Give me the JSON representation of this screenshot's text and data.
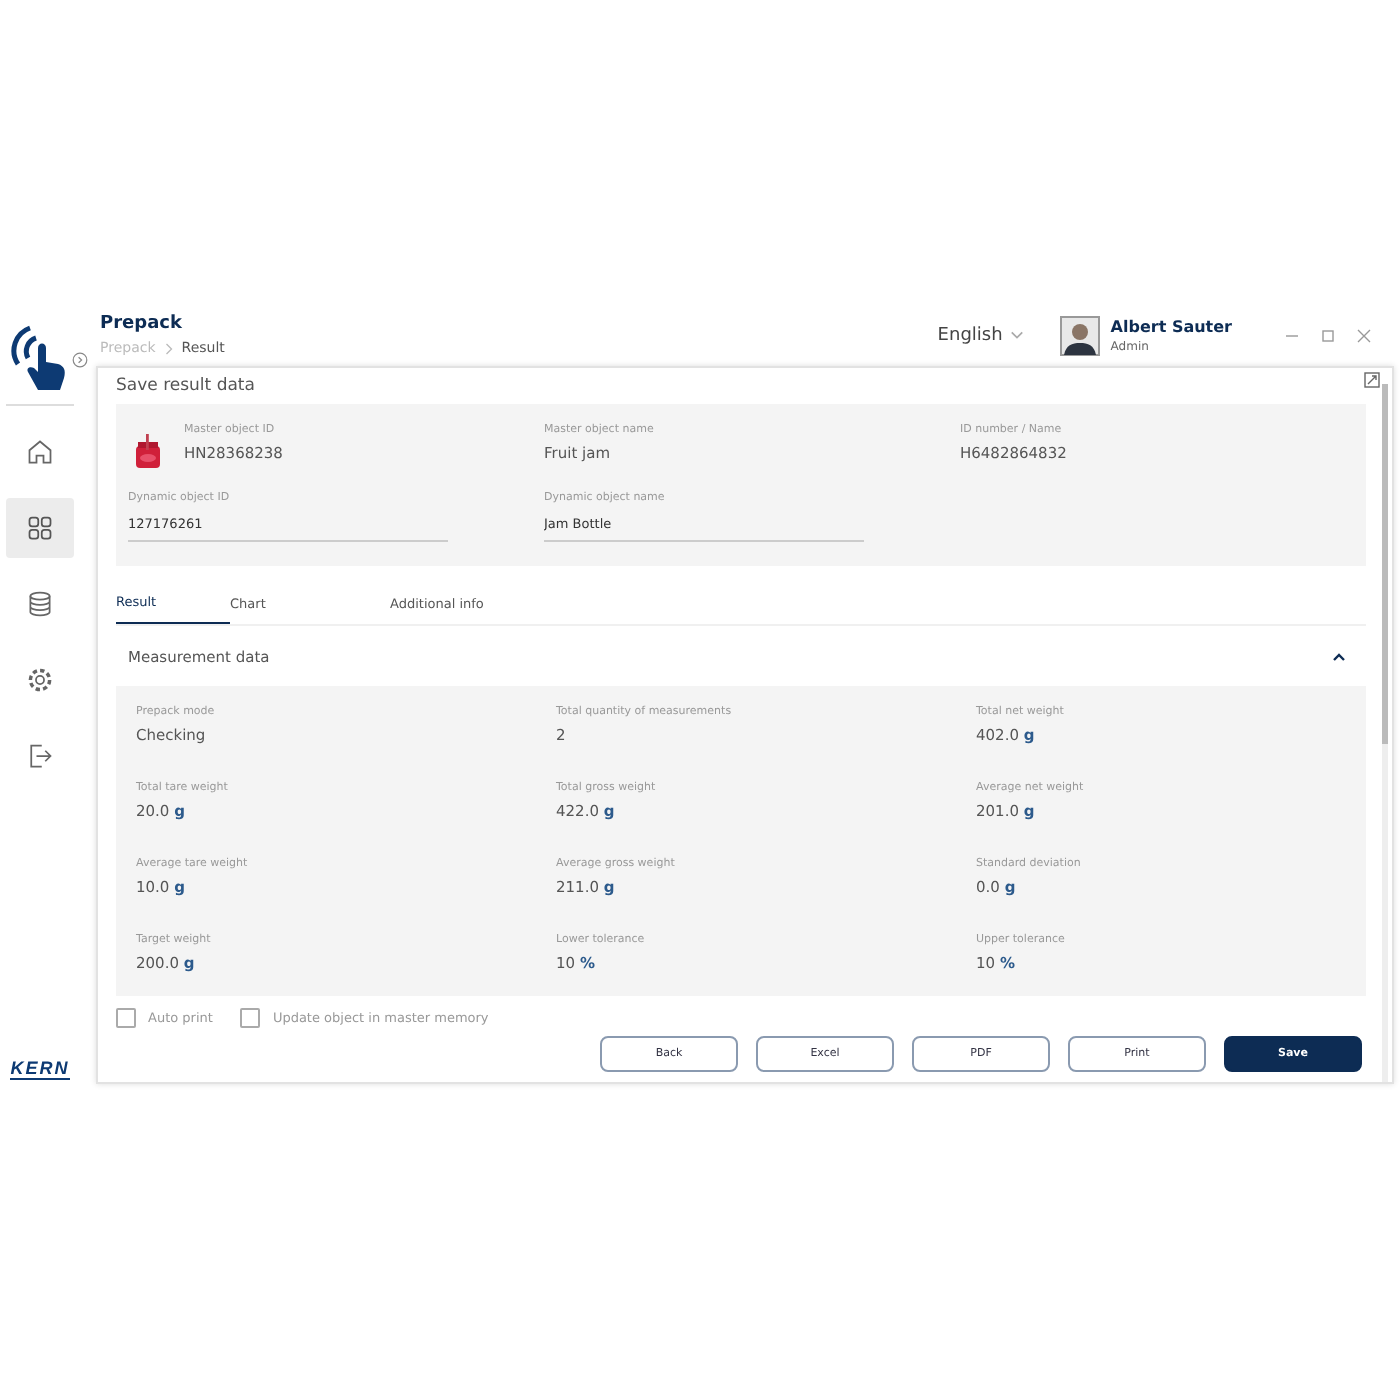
{
  "header": {
    "title": "Prepack",
    "breadcrumb": [
      "Prepack",
      "Result"
    ],
    "language": "English",
    "user": {
      "name": "Albert Sauter",
      "role": "Admin"
    }
  },
  "sidebar": {
    "items": [
      {
        "kind": "home",
        "selected": false
      },
      {
        "kind": "grid",
        "selected": true
      },
      {
        "kind": "database",
        "selected": false
      },
      {
        "kind": "settings",
        "selected": false
      },
      {
        "kind": "logout",
        "selected": false
      }
    ],
    "brand": "KERN"
  },
  "panel": {
    "title": "Save result data",
    "object": {
      "fields": [
        {
          "label": "Master object ID",
          "value": "HN28368238",
          "kind": "text"
        },
        {
          "label": "Master object name",
          "value": "Fruit jam",
          "kind": "text"
        },
        {
          "label": "ID number / Name",
          "value": "H6482864832",
          "kind": "text"
        },
        {
          "label": "Dynamic object ID",
          "value": "127176261",
          "kind": "input"
        },
        {
          "label": "Dynamic object name",
          "value": "Jam Bottle",
          "kind": "input"
        }
      ]
    },
    "tabs": [
      {
        "label": "Result",
        "selected": true
      },
      {
        "label": "Chart",
        "selected": false
      },
      {
        "label": "Additional info",
        "selected": false
      }
    ],
    "section": {
      "title": "Measurement data",
      "expanded": true,
      "fields": [
        {
          "label": "Prepack mode",
          "value": "Checking"
        },
        {
          "label": "Total quantity of measurements",
          "value": "2"
        },
        {
          "label": "Total net weight",
          "value": "402.0",
          "unit": "g"
        },
        {
          "label": "Total tare weight",
          "value": "20.0",
          "unit": "g"
        },
        {
          "label": "Total gross weight",
          "value": "422.0",
          "unit": "g"
        },
        {
          "label": "Average net weight",
          "value": "201.0",
          "unit": "g"
        },
        {
          "label": "Average tare weight",
          "value": "10.0",
          "unit": "g"
        },
        {
          "label": "Average gross weight",
          "value": "211.0",
          "unit": "g"
        },
        {
          "label": "Standard deviation",
          "value": "0.0",
          "unit": "g"
        },
        {
          "label": "Target weight",
          "value": "200.0",
          "unit": "g"
        },
        {
          "label": "Lower tolerance",
          "value": "10",
          "unit": "%"
        },
        {
          "label": "Upper tolerance",
          "value": "10",
          "unit": "%"
        }
      ]
    },
    "options": [
      {
        "label": "Auto print",
        "checked": false
      },
      {
        "label": "Update object in master memory",
        "checked": false
      }
    ],
    "buttons": [
      {
        "label": "Back",
        "kind": "secondary"
      },
      {
        "label": "Excel",
        "kind": "secondary"
      },
      {
        "label": "PDF",
        "kind": "secondary"
      },
      {
        "label": "Print",
        "kind": "secondary"
      },
      {
        "label": "Save",
        "kind": "primary"
      }
    ]
  }
}
